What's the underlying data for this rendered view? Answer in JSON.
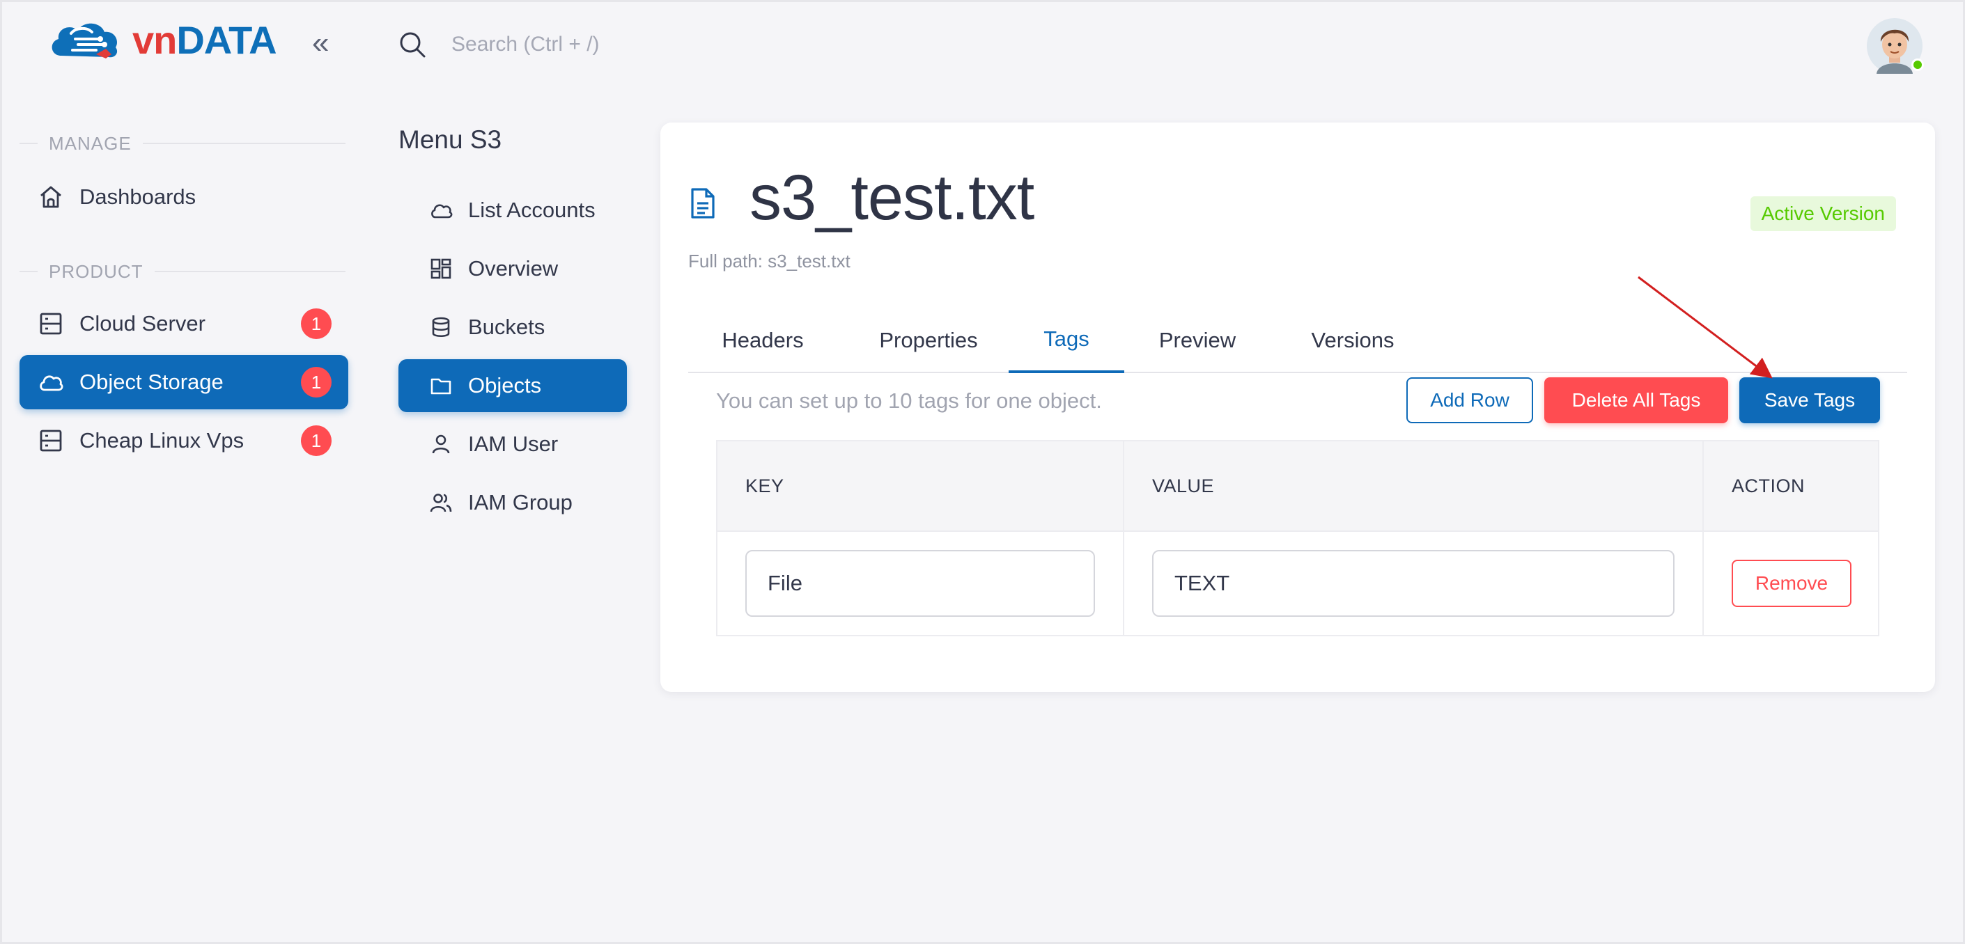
{
  "brand": {
    "logo_vn": "vn",
    "logo_data": "DATA"
  },
  "header": {
    "search_placeholder": "Search (Ctrl + /)"
  },
  "sidebar": {
    "manage_title": "MANAGE",
    "product_title": "PRODUCT",
    "items": [
      {
        "label": "Dashboards"
      },
      {
        "label": "Cloud Server",
        "badge": "1"
      },
      {
        "label": "Object Storage",
        "badge": "1"
      },
      {
        "label": "Cheap Linux Vps",
        "badge": "1"
      }
    ]
  },
  "s3menu": {
    "title": "Menu S3",
    "items": [
      {
        "label": "List Accounts"
      },
      {
        "label": "Overview"
      },
      {
        "label": "Buckets"
      },
      {
        "label": "Objects"
      },
      {
        "label": "IAM User"
      },
      {
        "label": "IAM Group"
      }
    ]
  },
  "object": {
    "name": "s3_test.txt",
    "status": "Active Version",
    "full_path": "Full path: s3_test.txt"
  },
  "tabs": [
    {
      "label": "Headers"
    },
    {
      "label": "Properties"
    },
    {
      "label": "Tags"
    },
    {
      "label": "Preview"
    },
    {
      "label": "Versions"
    }
  ],
  "tags": {
    "hint": "You can set up to 10 tags for one object.",
    "add_row": "Add Row",
    "delete_all": "Delete All Tags",
    "save": "Save Tags",
    "columns": [
      "KEY",
      "VALUE",
      "ACTION"
    ],
    "rows": [
      {
        "key": "File",
        "value": "TEXT",
        "action": "Remove"
      }
    ]
  },
  "colors": {
    "primary": "#0e6ab8",
    "danger": "#ff4c51",
    "success": "#56ca00",
    "annotation": "#d21f1f"
  }
}
